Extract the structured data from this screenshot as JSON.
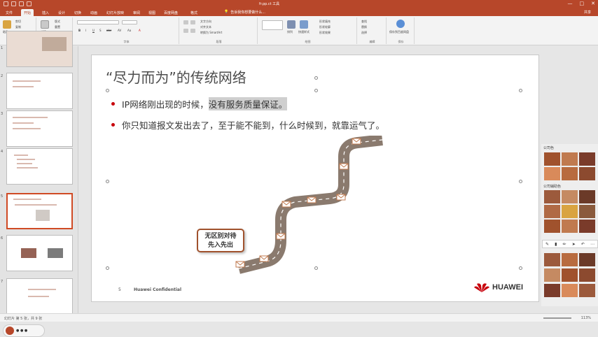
{
  "titlebar": {
    "doc_title": "fr.pp.ct 工具",
    "window_controls": [
      "—",
      "□",
      "✕"
    ]
  },
  "menu": {
    "tabs": [
      "文件",
      "开始",
      "插入",
      "设计",
      "切换",
      "动画",
      "幻灯片放映",
      "审阅",
      "视图",
      "百度网盘",
      "格式"
    ],
    "active": "开始",
    "tell_me": "告诉我你想要做什么...",
    "share": "共享"
  },
  "ribbon": {
    "groups": [
      {
        "label": "剪贴板",
        "items": [
          "粘贴",
          "剪切",
          "复制",
          "格式刷"
        ]
      },
      {
        "label": "幻灯片",
        "items": [
          "新建",
          "版式",
          "重置",
          "节"
        ]
      },
      {
        "label": "字体",
        "items": [
          "B",
          "I",
          "U",
          "S",
          "abc",
          "AV",
          "Aa",
          "A"
        ]
      },
      {
        "label": "段落",
        "items": [
          "文字方向",
          "对齐文本",
          "转换为 SmartArt"
        ]
      },
      {
        "label": "绘图",
        "items": [
          "排列",
          "快速样式",
          "形状填充",
          "形状轮廓",
          "形状效果"
        ]
      },
      {
        "label": "编辑",
        "items": [
          "查找",
          "替换",
          "选择"
        ]
      },
      {
        "label": "保存",
        "items": [
          "保存到百度网盘"
        ]
      }
    ]
  },
  "thumbnails": {
    "numbers": [
      "1",
      "2",
      "3",
      "4",
      "5",
      "6",
      "7"
    ],
    "selected": "5"
  },
  "slide": {
    "title": "“尽力而为”的传统网络",
    "bullet1_a": "IP网络刚出现的时候，",
    "bullet1_b": "没有服务质量保证。",
    "bullet2": "你只知道报文发出去了，至于能不能到，什么时候到，就靠运气了。",
    "callout_line1": "无区别对待",
    "callout_line2": "先入先出",
    "page_number": "5",
    "confidential": "Huawei Confidential",
    "logo_text": "HUAWEI"
  },
  "right_panel": {
    "company_colors_label": "公司色",
    "auxiliary_colors_label": "公司辅助色"
  },
  "statusbar": {
    "left": "幻灯片 第 5 张，共 9 张",
    "zoom": "113%"
  },
  "colors": {
    "brand": "#b7472a",
    "huawei_red": "#c7000b",
    "road": "#8a7a6e"
  }
}
